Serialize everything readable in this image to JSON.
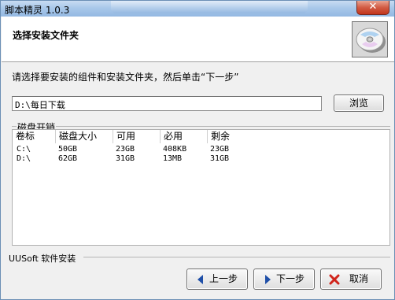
{
  "window": {
    "title": "脚本精灵 1.0.3",
    "close_glyph": "✕"
  },
  "header": {
    "title": "选择安装文件夹"
  },
  "instruction": "请选择要安装的组件和安装文件夹，然后单击“下一步”",
  "path": {
    "value": "D:\\每日下载"
  },
  "browse_label": "浏览",
  "disk_group": {
    "label": "磁盘开销",
    "columns": [
      "卷标",
      "磁盘大小",
      "可用",
      "必用",
      "剩余"
    ],
    "rows": [
      [
        "C:\\",
        "50GB",
        "23GB",
        "408KB",
        "23GB"
      ],
      [
        "D:\\",
        "62GB",
        "31GB",
        "13MB",
        "31GB"
      ]
    ]
  },
  "footer": {
    "label": "UUSoft 软件安装"
  },
  "buttons": {
    "back": "上一步",
    "next": "下一步",
    "cancel": "取消"
  },
  "icons": {
    "cd": "cd-install-icon",
    "back": "arrow-left-icon",
    "next": "arrow-right-icon",
    "cancel": "x-icon"
  },
  "colors": {
    "title_bar": "#a9c8ea",
    "close": "#c2361d",
    "arrow": "#1f4fa8",
    "cancel_x": "#d0241b"
  }
}
